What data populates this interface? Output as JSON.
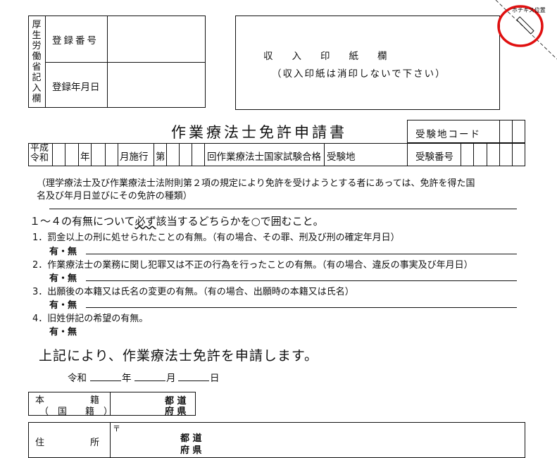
{
  "office": {
    "label": "厚生労働省記入欄",
    "reg_no_label": "登録番号",
    "reg_date_label": "登録年月日"
  },
  "stamp": {
    "line1": "収　　入　　印　　紙　　欄",
    "line2": "（収入印紙は消印しないで下さい）"
  },
  "staple": {
    "label": "ホチキス位置"
  },
  "form": {
    "title": "作業療法士免許申請書",
    "exam_site_code": "受験地コード"
  },
  "exam_row": {
    "era1": "平成",
    "era2": "令和",
    "year": "年",
    "month_exec": "月施行",
    "dai": "第",
    "exam_name": "回作業療法士国家試験合格",
    "exam_site": "受験地",
    "exam_number": "受験番号"
  },
  "note": {
    "line1": "（理学療法士及び作業療法士法附則第２項の規定により免許を受けようとする者にあっては、免許を得た国",
    "line2": "名及び年月日並びにその免許の種類）"
  },
  "questions": {
    "heading_prefix": "１～４の有無について",
    "heading_emph": "必ず",
    "heading_suffix": "該当するどちらかを○で囲むこと。",
    "answer": "有・無",
    "items": [
      "1．罰金以上の刑に処せられたことの有無。（有の場合、その罪、刑及び刑の確定年月日）",
      "2．作業療法士の業務に関し犯罪又は不正の行為を行ったことの有無。（有の場合、違反の事実及び年月日）",
      "3．出願後の本籍又は氏名の変更の有無。（有の場合、出願時の本籍又は氏名）",
      "4．旧姓併記の希望の有無。"
    ]
  },
  "apply": {
    "text": "上記により、作業療法士免許を申請します。"
  },
  "date": {
    "era": "令和",
    "year": "年",
    "month": "月",
    "day": "日"
  },
  "honseki": {
    "label1": "本　　　　　籍",
    "label2": "（　国　　籍　）",
    "pref1": "都 道",
    "pref2": "府 県"
  },
  "address": {
    "label": "住　　　　　所",
    "postal": "〒",
    "pref1": "都 道",
    "pref2": "府 県"
  }
}
